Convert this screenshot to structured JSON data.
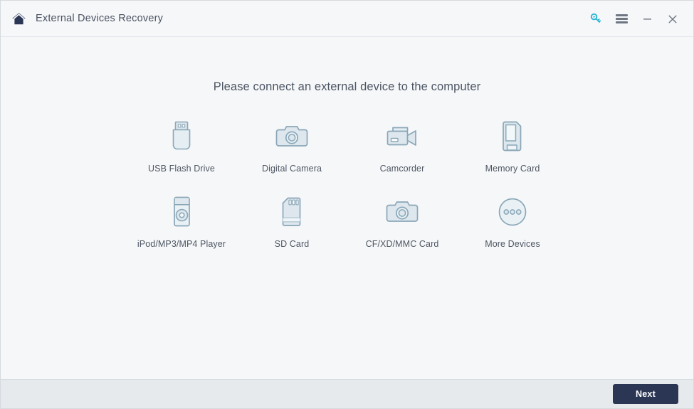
{
  "window": {
    "title": "External Devices Recovery",
    "home_icon": "home-icon",
    "controls": {
      "key_icon": "key-icon",
      "menu_icon": "hamburger-menu-icon",
      "minimize_icon": "minimize-icon",
      "close_icon": "close-icon"
    }
  },
  "main": {
    "headline": "Please connect an external device to the computer",
    "devices": [
      {
        "label": "USB Flash Drive",
        "icon": "usb-flash-drive-icon"
      },
      {
        "label": "Digital Camera",
        "icon": "digital-camera-icon"
      },
      {
        "label": "Camcorder",
        "icon": "camcorder-icon"
      },
      {
        "label": "Memory Card",
        "icon": "memory-card-icon"
      },
      {
        "label": "iPod/MP3/MP4 Player",
        "icon": "ipod-player-icon"
      },
      {
        "label": "SD Card",
        "icon": "sd-card-icon"
      },
      {
        "label": "CF/XD/MMC Card",
        "icon": "cf-xd-mmc-card-icon"
      },
      {
        "label": "More Devices",
        "icon": "more-devices-icon"
      }
    ]
  },
  "footer": {
    "next_label": "Next"
  },
  "colors": {
    "accent_key": "#23b4d4",
    "icon_stroke": "#8aa7b8",
    "icon_fill": "#dde7ed",
    "title_text": "#4a5260",
    "button_bg": "#2b3654",
    "window_bg": "#f6f7f9",
    "footer_bg": "#e7eaed"
  }
}
